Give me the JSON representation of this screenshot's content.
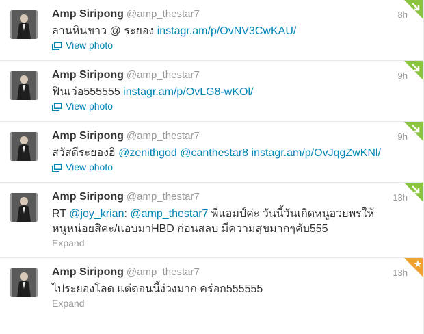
{
  "colors": {
    "link": "#0084b4",
    "muted": "#999999",
    "text": "#333333",
    "corner_green": "#8ac43f",
    "corner_orange": "#f0a030"
  },
  "tweets": [
    {
      "fullname": "Amp Siripong",
      "username": "@amp_thestar7",
      "time": "8h",
      "text": "ลานหินขาว @ ระยอง ",
      "link": "instagr.am/p/OvNV3CwKAU/",
      "action": "View photo",
      "corner": "green-check"
    },
    {
      "fullname": "Amp Siripong",
      "username": "@amp_thestar7",
      "time": "9h",
      "text": "ฟินเว่อ555555 ",
      "link": "instagr.am/p/OvLG8-wKOl/",
      "action": "View photo",
      "corner": "green-check"
    },
    {
      "fullname": "Amp Siripong",
      "username": "@amp_thestar7",
      "time": "9h",
      "text": "สวัสดีระยองฮิ ",
      "mention1": "@zenithgod",
      "mention2": "@canthestar8",
      "link": "instagr.am/p/OvJqgZwKNl/",
      "action": "View photo",
      "corner": "green-check"
    },
    {
      "fullname": "Amp Siripong",
      "username": "@amp_thestar7",
      "time": "13h",
      "rt": "RT ",
      "mention1": "@joy_krian",
      "colon": ": ",
      "mention2": "@amp_thestar7",
      "text": " พี่แอมป์ค่ะ วันนี้วันเกิดหนูอวยพรให้หนูหน่อยสิค่ะ/แอบมาHBD ก่อนสลบ มีความสุขมากๆคับ555",
      "action": "Expand",
      "corner": "green-check"
    },
    {
      "fullname": "Amp Siripong",
      "username": "@amp_thestar7",
      "time": "13h",
      "text": "ไประยองโลด แต่ตอนนี้ง่วงมาก คร่อก555555",
      "action": "Expand",
      "corner": "orange-star"
    }
  ]
}
